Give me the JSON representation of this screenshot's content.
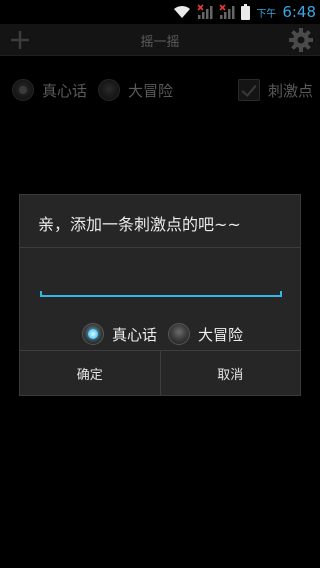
{
  "statusbar": {
    "ampm": "下午",
    "time": "6:48",
    "icons": [
      "wifi-icon",
      "signal-x-icon",
      "signal-x-icon",
      "battery-icon"
    ],
    "accent": "#33b5e5"
  },
  "actionbar": {
    "title": "摇一摇",
    "add_icon": "plus-icon",
    "settings_icon": "gear-icon"
  },
  "background_options": {
    "truth_label": "真心话",
    "dare_label": "大冒险",
    "exciting_label": "刺激点",
    "truth_selected": true,
    "dare_selected": false,
    "exciting_checked": true
  },
  "dialog": {
    "title": "亲，添加一条刺激点的吧~~",
    "input_value": "",
    "radio_truth_label": "真心话",
    "radio_dare_label": "大冒险",
    "selected": "truth",
    "confirm_label": "确定",
    "cancel_label": "取消"
  }
}
